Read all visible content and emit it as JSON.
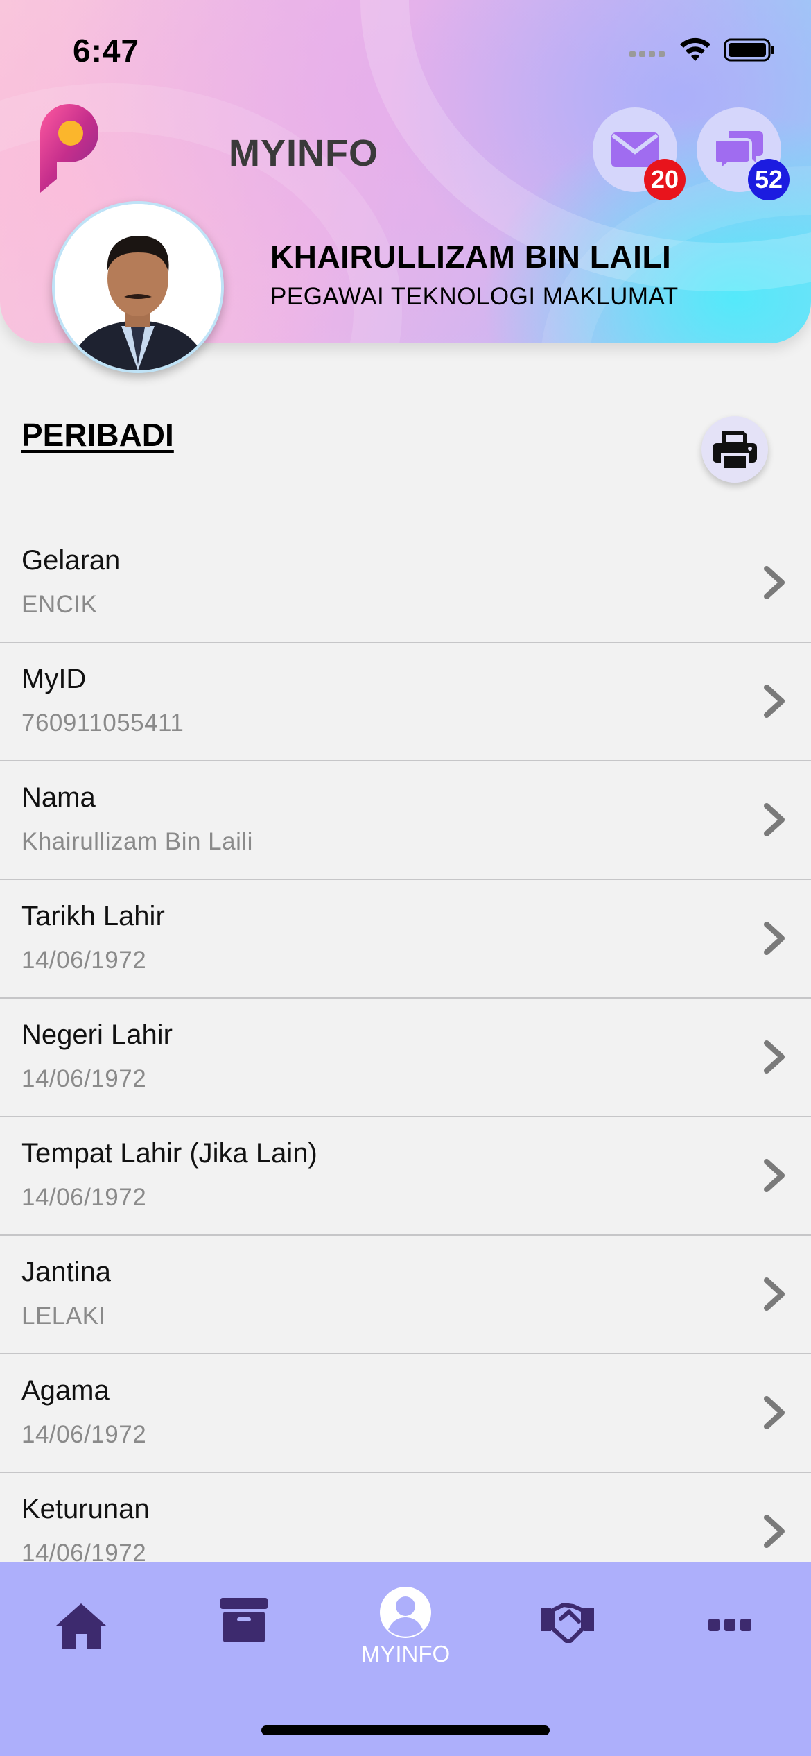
{
  "status_bar": {
    "time": "6:47"
  },
  "header": {
    "title": "MYINFO",
    "mail_count": "20",
    "chat_count": "52",
    "user_name": "KHAIRULLIZAM BIN LAILI",
    "user_role": "PEGAWAI TEKNOLOGI MAKLUMAT"
  },
  "section": {
    "title": "PERIBADI"
  },
  "fields": [
    {
      "label": "Gelaran",
      "value": "ENCIK"
    },
    {
      "label": "MyID",
      "value": "760911055411"
    },
    {
      "label": "Nama",
      "value": "Khairullizam Bin Laili"
    },
    {
      "label": "Tarikh Lahir",
      "value": "14/06/1972"
    },
    {
      "label": "Negeri Lahir",
      "value": "14/06/1972"
    },
    {
      "label": "Tempat Lahir (Jika Lain)",
      "value": "14/06/1972"
    },
    {
      "label": "Jantina",
      "value": "LELAKI"
    },
    {
      "label": "Agama",
      "value": "14/06/1972"
    },
    {
      "label": "Keturunan",
      "value": "14/06/1972"
    }
  ],
  "tabbar": {
    "tabs": [
      {
        "icon": "home-icon"
      },
      {
        "icon": "archive-icon"
      },
      {
        "icon": "user-circle-icon",
        "label": "MYINFO",
        "active": true
      },
      {
        "icon": "handshake-icon"
      },
      {
        "icon": "more-icon"
      }
    ]
  },
  "colors": {
    "tabbar_bg": "#adaffb",
    "icon_dark": "#3d2a6e",
    "mail_badge": "#e8141c",
    "chat_badge": "#1c1ce0",
    "button_circle": "#d5d6fb"
  }
}
